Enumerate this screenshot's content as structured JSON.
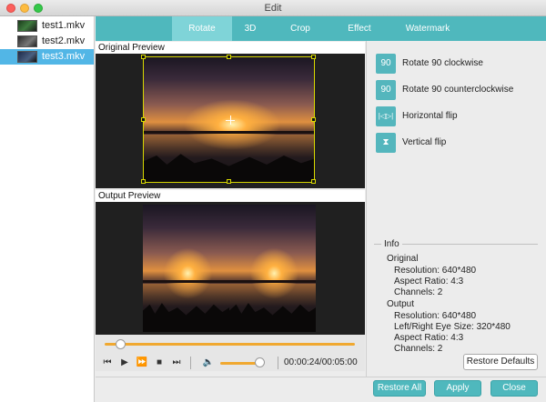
{
  "window": {
    "title": "Edit"
  },
  "files": [
    {
      "name": "test1.mkv"
    },
    {
      "name": "test2.mkv"
    },
    {
      "name": "test3.mkv",
      "selected": true
    }
  ],
  "tabs": [
    {
      "label": "Rotate",
      "active": true
    },
    {
      "label": "3D"
    },
    {
      "label": "Crop"
    },
    {
      "label": "Effect"
    },
    {
      "label": "Watermark"
    }
  ],
  "preview": {
    "original_label": "Original Preview",
    "output_label": "Output Preview"
  },
  "player": {
    "seek_fraction": 0.06,
    "volume_fraction": 0.9,
    "timecode": "00:00:24/00:05:00"
  },
  "actions": [
    {
      "label": "Rotate 90 clockwise",
      "icon": "rotate-cw-icon",
      "glyph": "90"
    },
    {
      "label": "Rotate 90 counterclockwise",
      "icon": "rotate-ccw-icon",
      "glyph": "90"
    },
    {
      "label": "Horizontal flip",
      "icon": "flip-horizontal-icon",
      "glyph": "|◁▷|"
    },
    {
      "label": "Vertical flip",
      "icon": "flip-vertical-icon",
      "glyph": "⧗"
    }
  ],
  "info": {
    "title": "Info",
    "original": {
      "heading": "Original",
      "resolution": "Resolution: 640*480",
      "aspect": "Aspect Ratio: 4:3",
      "channels": "Channels: 2"
    },
    "output": {
      "heading": "Output",
      "resolution": "Resolution: 640*480",
      "eye_size": "Left/Right Eye Size: 320*480",
      "aspect": "Aspect Ratio: 4:3",
      "channels": "Channels: 2"
    }
  },
  "buttons": {
    "restore_defaults": "Restore Defaults",
    "restore_all": "Restore All",
    "apply": "Apply",
    "close": "Close"
  },
  "colors": {
    "accent": "#4fb8bd",
    "selection": "#52b6e6",
    "progress": "#f0a830"
  }
}
